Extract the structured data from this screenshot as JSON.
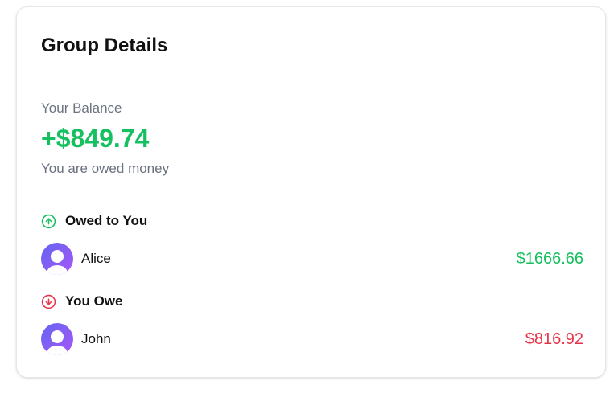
{
  "card": {
    "title": "Group Details"
  },
  "balance": {
    "label": "Your Balance",
    "amount": "+$849.74",
    "note": "You are owed money",
    "color": "#16c060"
  },
  "owed_to_you": {
    "heading": "Owed to You",
    "icon": "arrow-up-circle-icon",
    "color": "#16c060",
    "people": [
      {
        "name": "Alice",
        "amount": "$1666.66"
      }
    ]
  },
  "you_owe": {
    "heading": "You Owe",
    "icon": "arrow-down-circle-icon",
    "color": "#e5344a",
    "people": [
      {
        "name": "John",
        "amount": "$816.92"
      }
    ]
  }
}
